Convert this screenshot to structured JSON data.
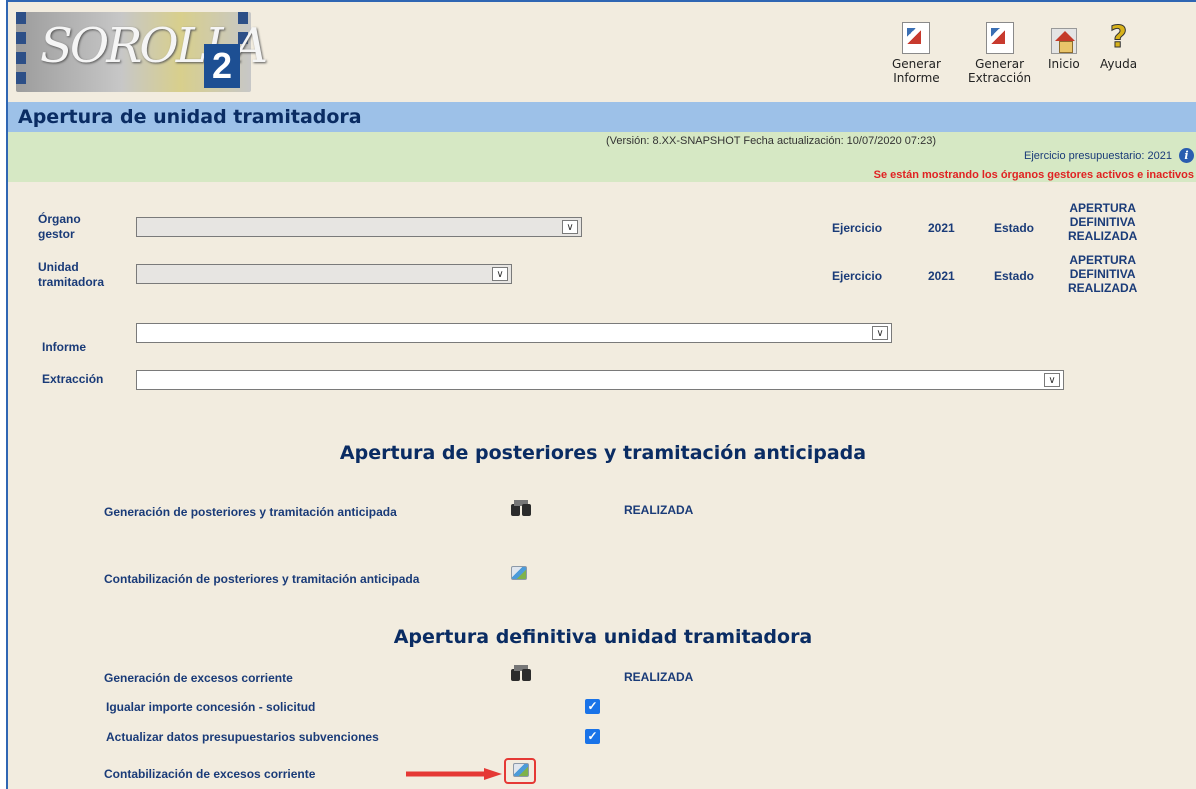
{
  "header": {
    "logo_text": "SOROLLA",
    "logo_number": "2",
    "toolbar": [
      {
        "line1": "Generar",
        "line2": "Informe"
      },
      {
        "line1": "Generar",
        "line2": "Extracción"
      },
      {
        "line1": "Inicio",
        "line2": ""
      },
      {
        "line1": "Ayuda",
        "line2": ""
      }
    ]
  },
  "page_title": "Apertura de unidad tramitadora",
  "info": {
    "version": "(Versión: 8.XX-SNAPSHOT Fecha actualización: 10/07/2020 07:23)",
    "ejercicio": "Ejercicio presupuestario: 2021",
    "activos": "Se están mostrando los órganos gestores activos e inactivos"
  },
  "form": {
    "organo_label_1": "Órgano",
    "organo_label_2": "gestor",
    "unidad_label_1": "Unidad",
    "unidad_label_2": "tramitadora",
    "informe_label": "Informe",
    "extraccion_label": "Extracción",
    "ejercicio_label": "Ejercicio",
    "ejercicio_value": "2021",
    "estado_label": "Estado",
    "estado_value_1": "APERTURA",
    "estado_value_2": "DEFINITIVA",
    "estado_value_3": "REALIZADA"
  },
  "section1": {
    "title": "Apertura de posteriores y tramitación anticipada",
    "row1_label": "Generación de posteriores y tramitación anticipada",
    "row1_status": "REALIZADA",
    "row2_label": "Contabilización de posteriores y tramitación anticipada"
  },
  "section2": {
    "title": "Apertura definitiva unidad tramitadora",
    "row1_label": "Generación de excesos corriente",
    "row1_status": "REALIZADA",
    "chk1_label": "Igualar importe concesión - solicitud",
    "chk1_checked": true,
    "chk2_label": "Actualizar datos presupuestarios subvenciones",
    "chk2_checked": true,
    "row2_label": "Contabilización de excesos corriente"
  },
  "colors": {
    "title_bar": "#9dc1e8",
    "info_bar": "#d6e8c4",
    "background": "#f2ecdf",
    "highlight": "#e53935"
  }
}
